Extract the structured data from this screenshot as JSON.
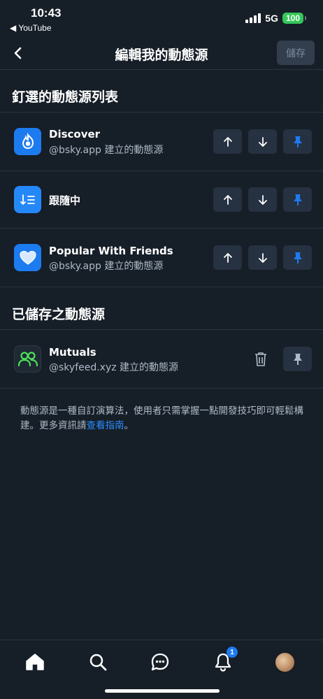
{
  "status_bar": {
    "time": "10:43",
    "back_app": "◀ YouTube",
    "network": "5G",
    "battery": "100"
  },
  "header": {
    "title": "編輯我的動態源",
    "save_label": "儲存"
  },
  "pinned": {
    "title": "釘選的動態源列表",
    "items": [
      {
        "name": "Discover",
        "creator": "@bsky.app 建立的動態源",
        "icon": "discover-icon",
        "color": "#1d7bf0"
      },
      {
        "name": "跟隨中",
        "creator": "",
        "icon": "following-icon",
        "color": "#2588f8"
      },
      {
        "name": "Popular With Friends",
        "creator": "@bsky.app 建立的動態源",
        "icon": "heart-icon",
        "color": "#1d7bf0"
      }
    ]
  },
  "saved": {
    "title": "已儲存之動態源",
    "items": [
      {
        "name": "Mutuals",
        "creator": "@skyfeed.xyz 建立的動態源",
        "icon": "mutuals-icon",
        "color": "#1f2934"
      }
    ]
  },
  "note": {
    "text": "動態源是一種自訂演算法，使用者只需掌握一點開發技巧即可輕鬆構建。更多資訊請",
    "link": "查看指南",
    "end": "。"
  },
  "nav": {
    "notifications_badge": "1",
    "items": [
      "home-icon",
      "search-icon",
      "chat-icon",
      "bell-icon",
      "avatar"
    ]
  },
  "colors": {
    "background": "#161e27",
    "accent": "#1d7bf0",
    "button": "#263141",
    "mutuals_green": "#4ce05a"
  }
}
